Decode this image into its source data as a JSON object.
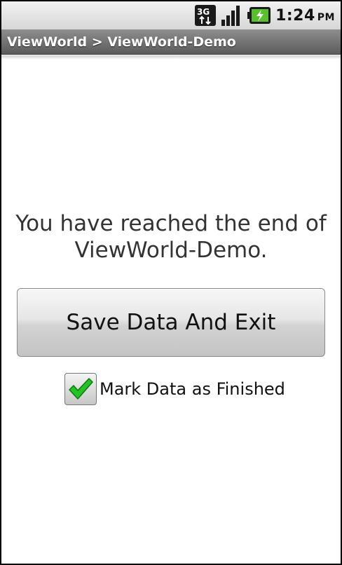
{
  "status_bar": {
    "network_icon": "3g-icon",
    "network_label": "3G",
    "signal_icon": "signal-strength-icon",
    "battery_icon": "battery-charging-icon",
    "time": "1:24",
    "ampm": "PM"
  },
  "title_bar": {
    "title": "ViewWorld > ViewWorld-Demo"
  },
  "main": {
    "message": "You have reached the end of\nViewWorld-Demo.",
    "save_button_label": "Save Data And Exit",
    "checkbox_label": "Mark Data as Finished",
    "checkbox_checked": true
  },
  "colors": {
    "checkmark": "#22c322",
    "title_bar": "#6e6e6e"
  }
}
